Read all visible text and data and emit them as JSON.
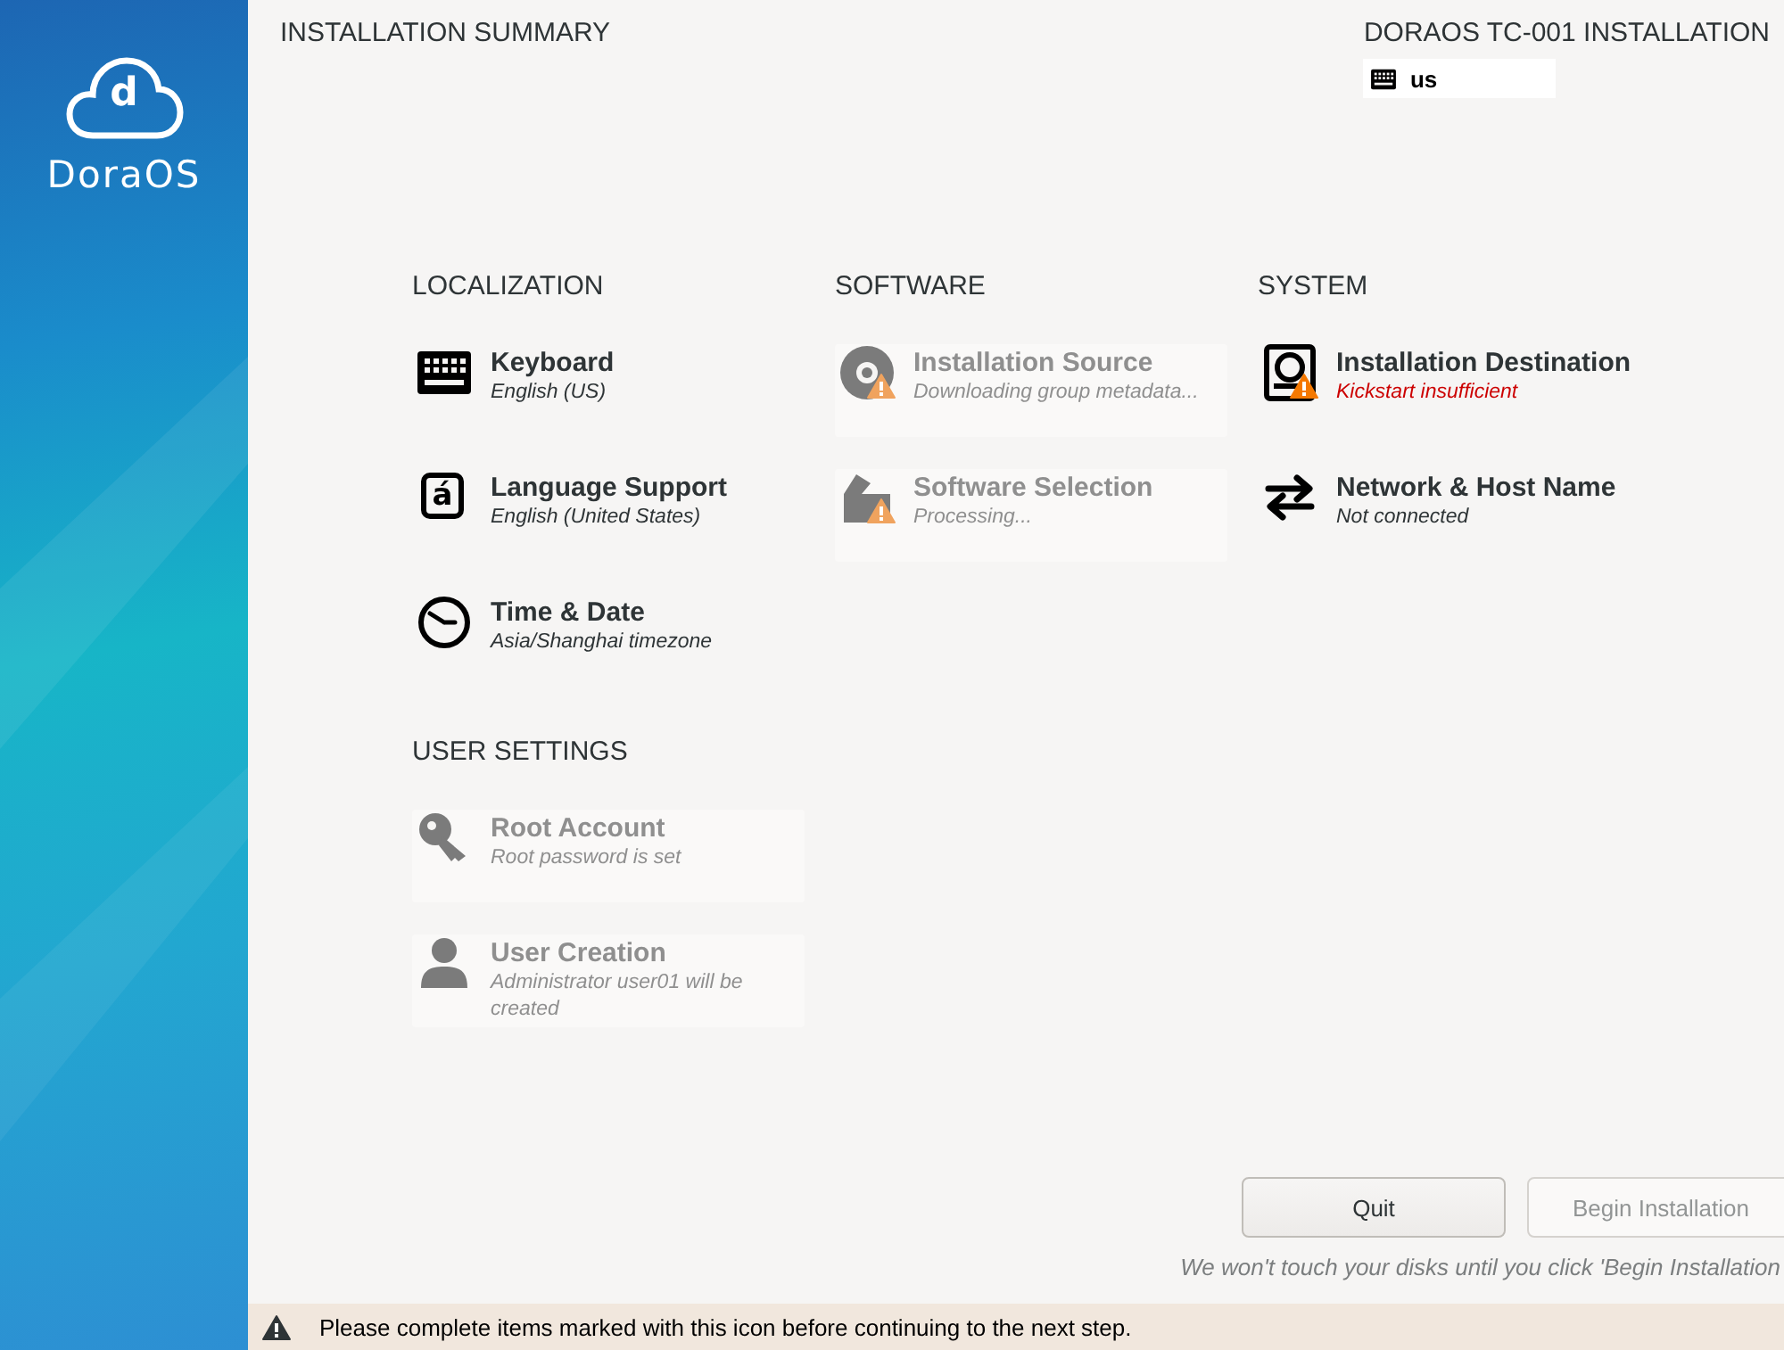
{
  "sidebar": {
    "logo_mark": "d",
    "logo_name": "DoraOS"
  },
  "header": {
    "title": "INSTALLATION SUMMARY",
    "product": "DORAOS TC-001 INSTALLATION",
    "keyboard_layout": "us"
  },
  "categories": [
    {
      "title": "LOCALIZATION",
      "spokes": [
        {
          "kind": "keyboard",
          "title": "Keyboard",
          "status": "English (US)",
          "disabled": false,
          "warning": false,
          "error": false
        },
        {
          "kind": "language",
          "glyph": "á",
          "title": "Language Support",
          "status": "English (United States)",
          "disabled": false,
          "warning": false,
          "error": false
        },
        {
          "kind": "clock",
          "title": "Time & Date",
          "status": "Asia/Shanghai timezone",
          "disabled": false,
          "warning": false,
          "error": false
        }
      ]
    },
    {
      "title": "SOFTWARE",
      "spokes": [
        {
          "kind": "disc",
          "title": "Installation Source",
          "status": "Downloading group metadata...",
          "disabled": true,
          "warning": true,
          "error": false
        },
        {
          "kind": "package",
          "title": "Software Selection",
          "status": "Processing...",
          "disabled": true,
          "warning": true,
          "error": false
        }
      ]
    },
    {
      "title": "SYSTEM",
      "spokes": [
        {
          "kind": "disk",
          "title": "Installation Destination",
          "status": "Kickstart insufficient",
          "disabled": false,
          "warning": true,
          "error": true
        },
        {
          "kind": "network",
          "title": "Network & Host Name",
          "status": "Not connected",
          "disabled": false,
          "warning": false,
          "error": false
        }
      ]
    },
    {
      "title": "USER SETTINGS",
      "spokes": [
        {
          "kind": "key",
          "title": "Root Account",
          "status": "Root password is set",
          "disabled": true,
          "warning": false,
          "error": false
        },
        {
          "kind": "user",
          "title": "User Creation",
          "status": "Administrator user01 will be created",
          "disabled": true,
          "warning": false,
          "error": false
        }
      ]
    }
  ],
  "buttons": [
    {
      "label": "Quit",
      "disabled": false
    },
    {
      "label": "Begin Installation",
      "disabled": true
    }
  ],
  "note": "We won't touch your disks until you click 'Begin Installation",
  "warning_bar": {
    "message": "Please complete items marked with this icon before continuing to the next step."
  }
}
